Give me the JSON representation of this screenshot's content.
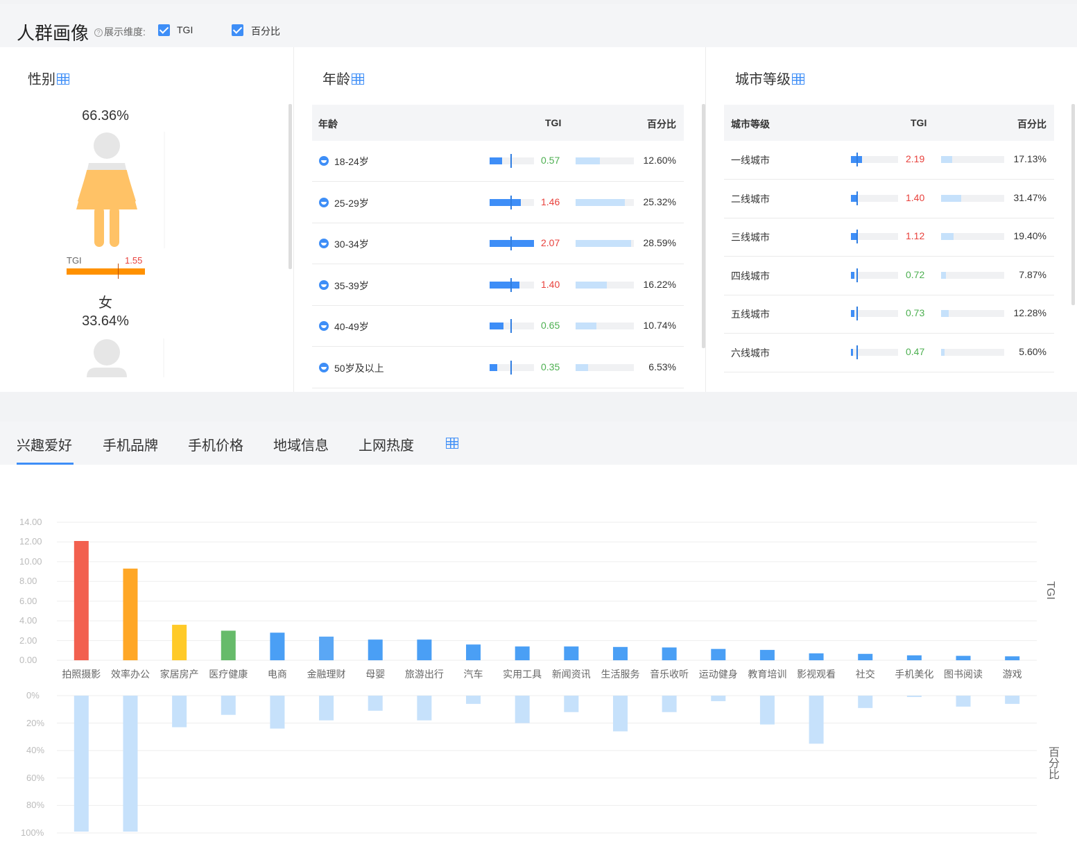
{
  "header": {
    "title": "人群画像",
    "dim_label": "展示维度:",
    "help_glyph": "?",
    "opt_tgi": "TGI",
    "opt_pct": "百分比"
  },
  "gender": {
    "title": "性别",
    "female_pct": "66.36%",
    "tgi_label": "TGI",
    "tgi_value": "1.55",
    "female_label": "女",
    "male_pct": "33.64%"
  },
  "age": {
    "title": "年龄",
    "col_name": "年龄",
    "col_tgi": "TGI",
    "col_pct": "百分比",
    "rows": [
      {
        "label": "18-24岁",
        "tgi": "0.57",
        "pct": "12.60%",
        "tgi_num": 0.57,
        "pct_num": 12.6
      },
      {
        "label": "25-29岁",
        "tgi": "1.46",
        "pct": "25.32%",
        "tgi_num": 1.46,
        "pct_num": 25.32
      },
      {
        "label": "30-34岁",
        "tgi": "2.07",
        "pct": "28.59%",
        "tgi_num": 2.07,
        "pct_num": 28.59
      },
      {
        "label": "35-39岁",
        "tgi": "1.40",
        "pct": "16.22%",
        "tgi_num": 1.4,
        "pct_num": 16.22
      },
      {
        "label": "40-49岁",
        "tgi": "0.65",
        "pct": "10.74%",
        "tgi_num": 0.65,
        "pct_num": 10.74
      },
      {
        "label": "50岁及以上",
        "tgi": "0.35",
        "pct": "6.53%",
        "tgi_num": 0.35,
        "pct_num": 6.53
      }
    ]
  },
  "city": {
    "title": "城市等级",
    "col_name": "城市等级",
    "col_tgi": "TGI",
    "col_pct": "百分比",
    "rows": [
      {
        "label": "一线城市",
        "tgi": "2.19",
        "pct": "17.13%",
        "tgi_num": 2.19,
        "pct_num": 17.13
      },
      {
        "label": "二线城市",
        "tgi": "1.40",
        "pct": "31.47%",
        "tgi_num": 1.4,
        "pct_num": 31.47
      },
      {
        "label": "三线城市",
        "tgi": "1.12",
        "pct": "19.40%",
        "tgi_num": 1.12,
        "pct_num": 19.4
      },
      {
        "label": "四线城市",
        "tgi": "0.72",
        "pct": "7.87%",
        "tgi_num": 0.72,
        "pct_num": 7.87
      },
      {
        "label": "五线城市",
        "tgi": "0.73",
        "pct": "12.28%",
        "tgi_num": 0.73,
        "pct_num": 12.28
      },
      {
        "label": "六线城市",
        "tgi": "0.47",
        "pct": "5.60%",
        "tgi_num": 0.47,
        "pct_num": 5.6
      }
    ]
  },
  "tabs": [
    "兴趣爱好",
    "手机品牌",
    "手机价格",
    "地域信息",
    "上网热度"
  ],
  "colors": {
    "accent": "#3e8ef7",
    "up": "#e8413c",
    "down": "#4caf50",
    "female": "#ffc266",
    "pct_bar": "#c6e1fb"
  },
  "chart_data": {
    "type": "bar",
    "categories": [
      "拍照摄影",
      "效率办公",
      "家居房产",
      "医疗健康",
      "电商",
      "金融理财",
      "母婴",
      "旅游出行",
      "汽车",
      "实用工具",
      "新闻资讯",
      "生活服务",
      "音乐收听",
      "运动健身",
      "教育培训",
      "影视观看",
      "社交",
      "手机美化",
      "图书阅读",
      "游戏"
    ],
    "series": [
      {
        "name": "TGI",
        "values": [
          12.1,
          9.3,
          3.6,
          3.0,
          2.8,
          2.4,
          2.1,
          2.1,
          1.6,
          1.4,
          1.4,
          1.35,
          1.3,
          1.15,
          1.05,
          0.7,
          0.65,
          0.5,
          0.45,
          0.4
        ]
      },
      {
        "name": "百分比",
        "values": [
          99,
          99,
          23,
          14,
          24,
          18,
          11,
          18,
          6,
          20,
          12,
          26,
          12,
          4,
          21,
          35,
          9,
          1,
          8,
          6
        ]
      }
    ],
    "bar_colors": [
      "#f2604f",
      "#ffa726",
      "#ffca28",
      "#66bb6a",
      "#4a9ff5",
      "#5aa7f5",
      "#4a9ff5",
      "#4a9ff5",
      "#4a9ff5",
      "#4a9ff5",
      "#4a9ff5",
      "#4a9ff5",
      "#4a9ff5",
      "#4a9ff5",
      "#4a9ff5",
      "#4a9ff5",
      "#4a9ff5",
      "#4a9ff5",
      "#4a9ff5",
      "#4a9ff5"
    ],
    "ylim_tgi": [
      0,
      14
    ],
    "yticks_tgi": [
      "14.00",
      "12.00",
      "10.00",
      "8.00",
      "6.00",
      "4.00",
      "2.00",
      "0.00"
    ],
    "ylim_pct": [
      0,
      100
    ],
    "yticks_pct": [
      "0%",
      "20%",
      "40%",
      "60%",
      "80%",
      "100%"
    ],
    "ylabel_top": "TGI",
    "ylabel_bottom": "百分比",
    "grid": true
  }
}
